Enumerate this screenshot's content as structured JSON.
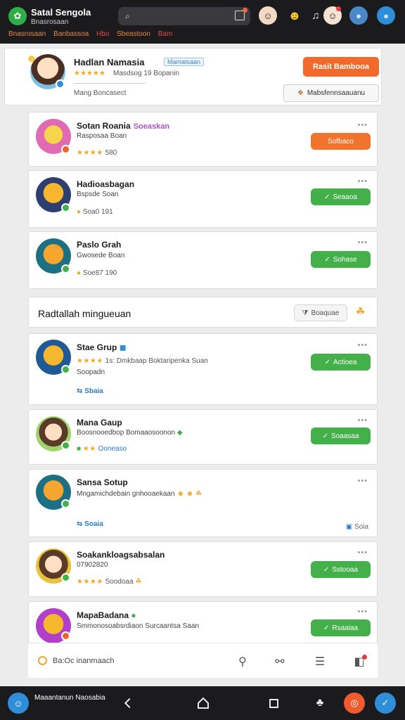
{
  "app": {
    "title": "Satal Sengola",
    "subtitle": "Bnasrosaan"
  },
  "search": {
    "placeholder": ""
  },
  "nav": {
    "items": [
      "Bnasrosaan",
      "Banbassoa",
      "Hbo",
      "Sbeastoon",
      "Bam"
    ]
  },
  "profile": {
    "name": "Hadlan Namasia",
    "tag": "Mamatsaan",
    "stats": "Masdsog 19 Bopanin",
    "status": "Mang Boncasect",
    "primary_button": "Rasit Bambooa",
    "secondary_button": "Mabsfennsaauanu",
    "rating": 5
  },
  "friends": [
    {
      "name": "Sotan Roania",
      "tag": "Soeaskan",
      "sub": "Rasposaa Boan",
      "meta": "580",
      "stars": 4,
      "button": "Sofbaco",
      "button_color": "#f2742c"
    },
    {
      "name": "Hadioasbagan",
      "sub": "Bspsde Soan",
      "meta": "Soa0  191",
      "button": "Seaaoa",
      "button_color": "#44b04a"
    },
    {
      "name": "Paslo Grah",
      "sub": "Gwosede Boan",
      "meta": "Soe87  190",
      "button": "Sohase",
      "button_color": "#44b04a"
    }
  ],
  "section": {
    "title": "Radtallah mingueuan",
    "sort_label": "Boaquae"
  },
  "groups": [
    {
      "name": "Stae Grup",
      "sub": "1s: Dmkbaap Boktaripenka Suan",
      "meta": "Soopadn",
      "link": "Sbaia",
      "stars": 4,
      "button": "Actioea",
      "button_color": "#44b04a"
    },
    {
      "name": "Mana Gaup",
      "sub": "Boosnooedbop Bomaaosoonon",
      "meta": "Ooneaso",
      "stars": 2,
      "button": "Soaasaa",
      "button_color": "#44b04a"
    },
    {
      "name": "Sansa Sotup",
      "sub": "Mngamichdebain gnhooaekaan",
      "link": "Soaia",
      "extra": "Soia",
      "button": "",
      "button_color": ""
    },
    {
      "name": "Soakankloagsabsalan",
      "sub": "07902820",
      "meta": "Soodoaa",
      "stars": 4,
      "button": "Sstooaa",
      "button_color": "#44b04a"
    },
    {
      "name": "MapaBadana",
      "sub": "Smmonosoabsrdiaon Surcaantsa Saan",
      "button": "Rsaaiaa",
      "button_color": "#44b04a"
    }
  ],
  "composer": {
    "placeholder": "Ba:Oc inanmaach"
  },
  "navbar": {
    "account_label": "Maaantanun Naosabia"
  }
}
